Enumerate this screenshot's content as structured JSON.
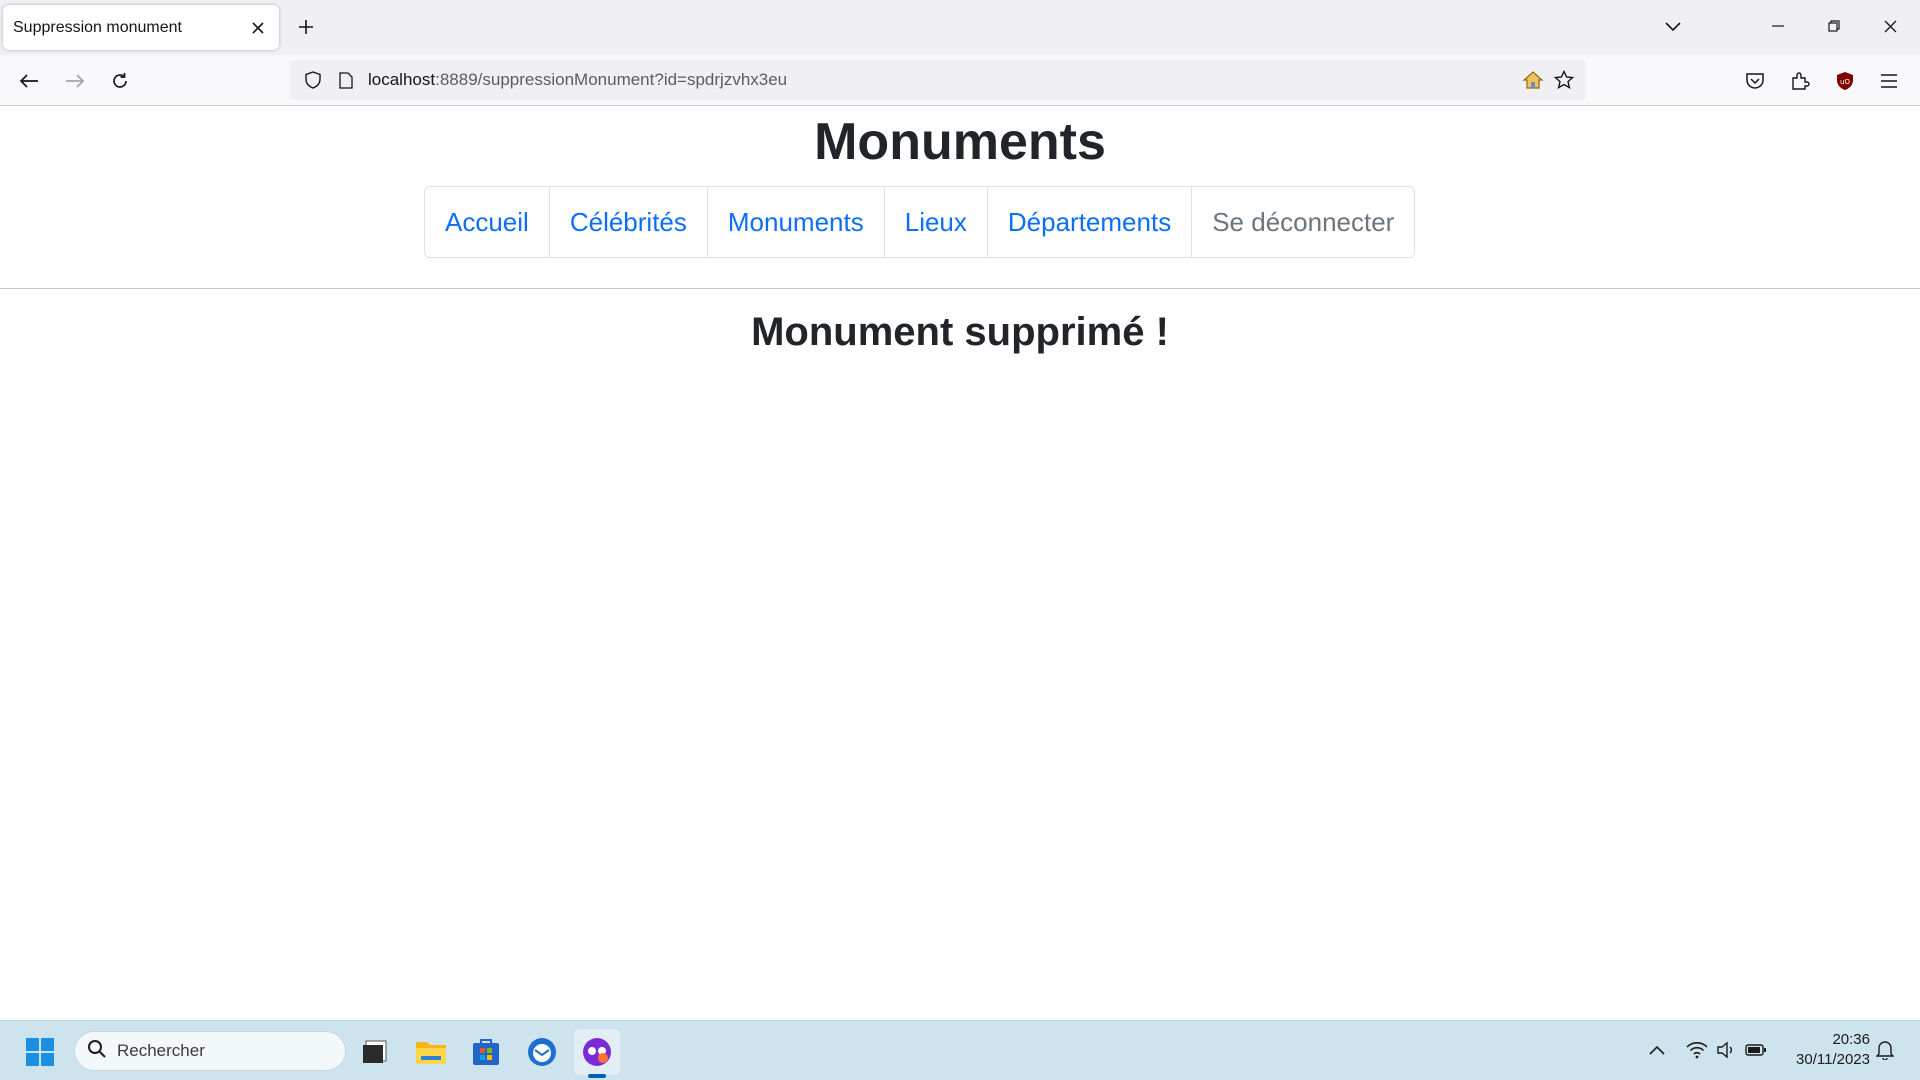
{
  "browser": {
    "tab_title": "Suppression monument",
    "url_host": "localhost",
    "url_path": ":8889/suppressionMonument?id=spdrjzvhx3eu"
  },
  "page": {
    "site_title": "Monuments",
    "menu": [
      "Accueil",
      "Célébrités",
      "Monuments",
      "Lieux",
      "Départements",
      "Se déconnecter"
    ],
    "message": "Monument supprimé !"
  },
  "taskbar": {
    "search_placeholder": "Rechercher",
    "time": "20:36",
    "date": "30/11/2023"
  },
  "colors": {
    "link": "#0d6efd",
    "muted": "#6c757d",
    "taskbar_bg": "#cde4ee"
  }
}
